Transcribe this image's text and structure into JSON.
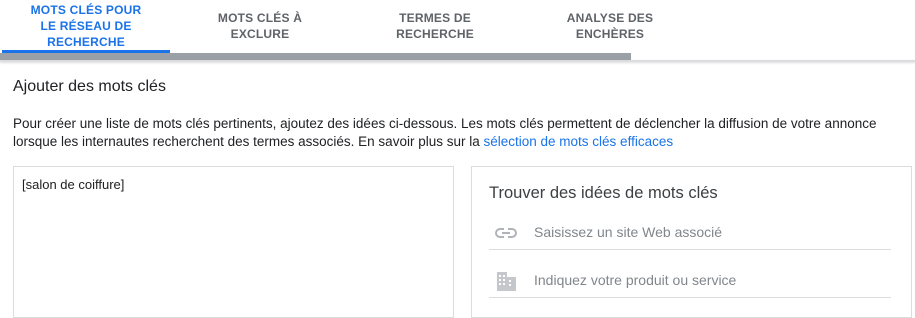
{
  "tabs": [
    {
      "label": "MOTS CLÉS POUR LE RÉSEAU DE RECHERCHE",
      "active": true
    },
    {
      "label": "MOTS CLÉS À EXCLURE",
      "active": false
    },
    {
      "label": "TERMES DE RECHERCHE",
      "active": false
    },
    {
      "label": "ANALYSE DES ENCHÈRES",
      "active": false
    }
  ],
  "section": {
    "title": "Ajouter des mots clés",
    "description": "Pour créer une liste de mots clés pertinents, ajoutez des idées ci-dessous. Les mots clés permettent de déclencher la diffusion de votre annonce lorsque les internautes recherchent des termes associés. En savoir plus sur la",
    "link_text": "sélection de mots clés efficaces"
  },
  "keywords_box": {
    "value": "[salon de coiffure]"
  },
  "ideas_panel": {
    "title": "Trouver des idées de mots clés",
    "website_placeholder": "Saisissez un site Web associé",
    "product_placeholder": "Indiquez votre produit ou service",
    "icons": [
      "link-icon",
      "business-icon"
    ]
  },
  "colors": {
    "accent": "#1a73e8",
    "tab_inactive": "#5f6368",
    "placeholder": "#80868b",
    "border": "#dadce0"
  }
}
